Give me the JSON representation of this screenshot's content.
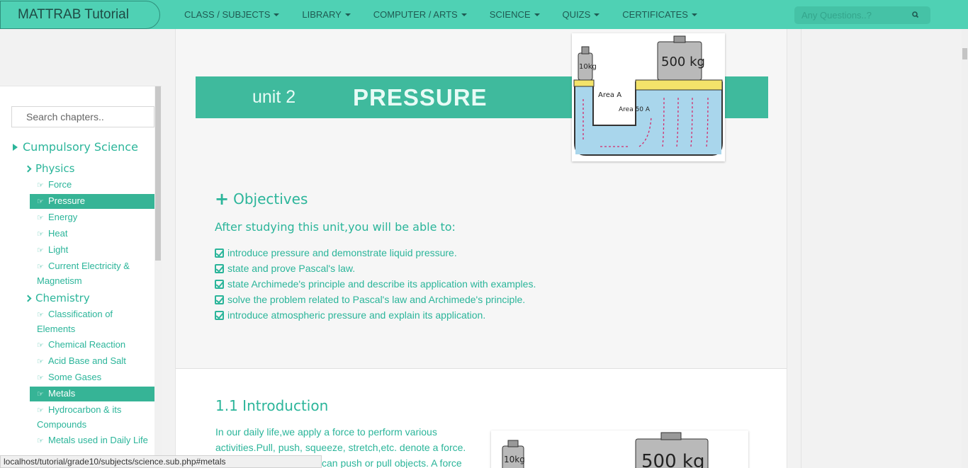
{
  "navbar": {
    "brand": "MATTRAB Tutorial",
    "menu": [
      {
        "label": "CLASS / SUBJECTS"
      },
      {
        "label": "LIBRARY"
      },
      {
        "label": "COMPUTER / ARTS"
      },
      {
        "label": "SCIENCE"
      },
      {
        "label": "QUIZS"
      },
      {
        "label": "CERTIFICATES"
      }
    ],
    "search_placeholder": "Any Questions..?",
    "search_icon": "search-icon"
  },
  "sidebar": {
    "search_placeholder": "Search chapters..",
    "root": "Cumpulsory Science",
    "groups": [
      {
        "label": "Physics",
        "items": [
          "Force",
          "Pressure",
          "Energy",
          "Heat",
          "Light",
          "Current Electricity & Magnetism"
        ]
      },
      {
        "label": "Chemistry",
        "items": [
          "Classification of Elements",
          "Chemical Reaction",
          "Acid Base and Salt",
          "Some Gases",
          "Metals",
          "Hydrocarbon & its Compounds",
          "Metals used in Daily Life"
        ]
      }
    ],
    "active_items": [
      "Pressure",
      "Metals"
    ],
    "item_icon": "hand-point-right-icon"
  },
  "main": {
    "unit_label": "unit 2",
    "unit_title": "PRESSURE",
    "figure": {
      "small_weight": "10kg",
      "big_weight": "500 kg",
      "area_small": "Area A",
      "area_big": "Area 50 A"
    },
    "objectives": {
      "heading": "Objectives",
      "subheading": "After studying this unit,you will be able to:",
      "items": [
        "introduce pressure and demonstrate liquid pressure.",
        "state and prove Pascal's law.",
        "state Archimede's principle and describe its application with examples.",
        "solve the problem related to Pascal's law and Archimede's principle.",
        "introduce atmospheric pressure and explain its application."
      ]
    },
    "intro": {
      "heading": "1.1 Introduction",
      "lines": [
        "In our daily life,we apply a force to perform various",
        "activities.Pull, push, squeeze, stretch,etc. denote a force.",
        "can push or pull objects. A force"
      ]
    },
    "figure2": {
      "small_weight": "10kg",
      "big_weight": "500 kg"
    }
  },
  "status_bar": "localhost/tutorial/grade10/subjects/science.sub.php#metals",
  "colors": {
    "accent": "#4fd1b4",
    "banner": "#3fba9d",
    "text": "#2bb59a",
    "active": "#36b496"
  }
}
